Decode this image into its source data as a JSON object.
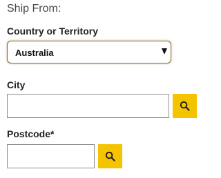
{
  "ship_from": {
    "title": "Ship From:",
    "country": {
      "label": "Country or Territory",
      "selected_value": "Australia"
    },
    "city": {
      "label": "City",
      "value": "",
      "search_icon": "search-icon"
    },
    "postcode": {
      "label": "Postcode*",
      "value": "",
      "search_icon": "search-icon"
    }
  },
  "colors": {
    "accent_button": "#f5c400",
    "select_border": "#8a6a3a",
    "input_border": "#8c8c8c"
  }
}
